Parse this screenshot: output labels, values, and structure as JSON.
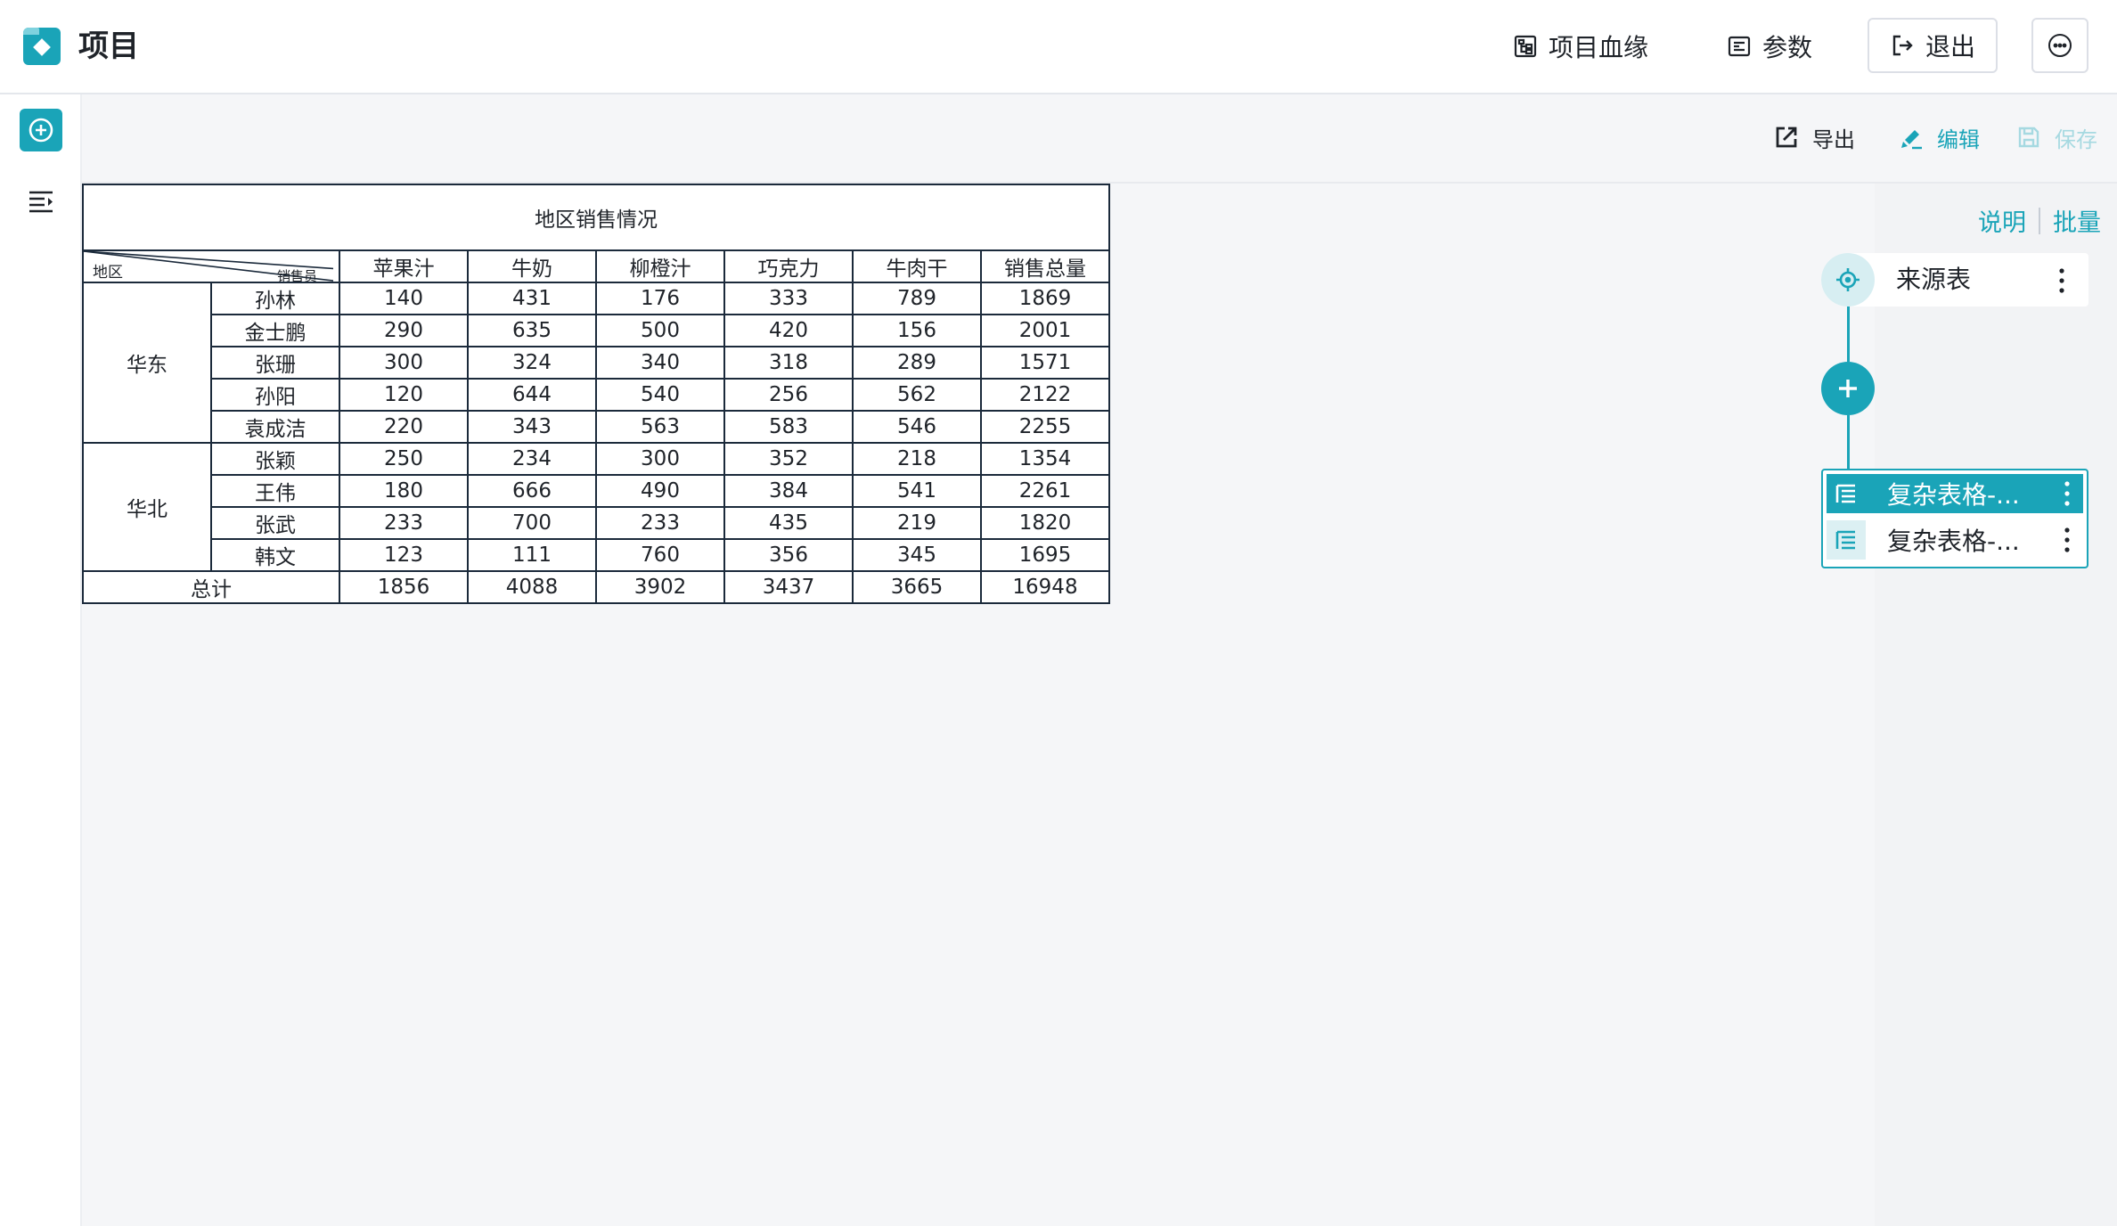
{
  "header": {
    "title": "项目",
    "lineage_label": "项目血缘",
    "params_label": "参数",
    "exit_label": "退出"
  },
  "toolbar": {
    "export_label": "导出",
    "edit_label": "编辑",
    "save_label": "保存"
  },
  "report": {
    "title": "地区销售情况",
    "corner_area": "地区",
    "corner_emp": "销售员",
    "columns": [
      "苹果汁",
      "牛奶",
      "柳橙汁",
      "巧克力",
      "牛肉干",
      "销售总量"
    ],
    "regions": [
      {
        "name": "华东",
        "rows": [
          {
            "name": "孙林",
            "values": [
              "140",
              "431",
              "176",
              "333",
              "789",
              "1869"
            ]
          },
          {
            "name": "金士鹏",
            "values": [
              "290",
              "635",
              "500",
              "420",
              "156",
              "2001"
            ]
          },
          {
            "name": "张珊",
            "values": [
              "300",
              "324",
              "340",
              "318",
              "289",
              "1571"
            ]
          },
          {
            "name": "孙阳",
            "values": [
              "120",
              "644",
              "540",
              "256",
              "562",
              "2122"
            ]
          },
          {
            "name": "袁成洁",
            "values": [
              "220",
              "343",
              "563",
              "583",
              "546",
              "2255"
            ]
          }
        ]
      },
      {
        "name": "华北",
        "rows": [
          {
            "name": "张颖",
            "values": [
              "250",
              "234",
              "300",
              "352",
              "218",
              "1354"
            ]
          },
          {
            "name": "王伟",
            "values": [
              "180",
              "666",
              "490",
              "384",
              "541",
              "2261"
            ]
          },
          {
            "name": "张武",
            "values": [
              "233",
              "700",
              "233",
              "435",
              "219",
              "1820"
            ]
          },
          {
            "name": "韩文",
            "values": [
              "123",
              "111",
              "760",
              "356",
              "345",
              "1695"
            ]
          }
        ]
      }
    ],
    "total_label": "总计",
    "totals": [
      "1856",
      "4088",
      "3902",
      "3437",
      "3665",
      "16948"
    ]
  },
  "panel": {
    "link_desc": "说明",
    "link_batch": "批量",
    "source_label": "来源表",
    "datasets": [
      {
        "label": "复杂表格-...",
        "active": true
      },
      {
        "label": "复杂表格-...",
        "active": false
      }
    ]
  },
  "colors": {
    "accent": "#1aa4b8",
    "border": "#1b2a3b"
  },
  "icons": {
    "logo": "folder-logo-icon",
    "lineage": "lineage-icon",
    "params": "params-icon",
    "exit": "logout-icon",
    "more": "more-icon",
    "rail_add": "add-circle-icon",
    "rail_list": "list-indent-icon",
    "export": "export-icon",
    "edit": "edit-icon",
    "save": "save-icon",
    "source": "target-icon",
    "dataset": "table-icon",
    "menu": "kebab-icon"
  }
}
